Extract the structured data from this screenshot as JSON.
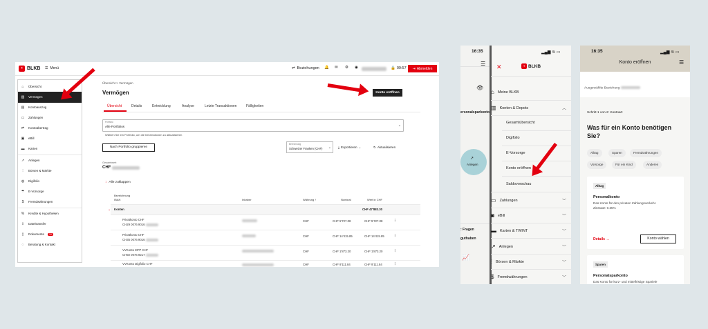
{
  "desktop": {
    "brand": "BLKB",
    "menu": "Menü",
    "top": {
      "relations": "Beziehungen",
      "time": "09:57",
      "logout": "Abmelden"
    },
    "sidebar": [
      "Übersicht",
      "Vermögen",
      "Kontoauszug",
      "Zahlungen",
      "Kontoübertrag",
      "eBill",
      "Karten",
      "Anlegen",
      "Börsen & Märkte",
      "Digifolio",
      "E-Vorsorge",
      "Fremdwährungen",
      "Kredite & Hypotheken",
      "Dateitransfer",
      "Dokumente",
      "Beratung & Kontakt"
    ],
    "doc_badge": "10",
    "breadcrumb": "Übersicht > Vermögen",
    "title": "Vermögen",
    "open_account": "Konto eröffnen",
    "tabs": [
      "Übersicht",
      "Details",
      "Entwicklung",
      "Analyse",
      "Letzte Transaktionen",
      "Fälligkeiten"
    ],
    "portfolio_label": "Portfolio",
    "portfolio_value": "Alle Portfolios",
    "portfolio_hint": "Wählen Sie ein Portfolio, um die Informationen zu aktualisieren",
    "group_button": "Nach Portfolio gruppieren",
    "currency_label": "Berechnung",
    "currency_value": "Schweizer Franken (CHF)",
    "export": "Exportieren",
    "refresh": "Aktualisieren",
    "total_label": "Gesamtwert",
    "total_prefix": "CHF",
    "collapse": "Alle zuklappen",
    "cols": {
      "name": "Bezeichnung",
      "iban": "IBAN",
      "holder": "Inhaber",
      "currency": "Währung",
      "nominal": "Nominal",
      "value": "Wert in CHF"
    },
    "group": {
      "name": "Konten",
      "value": "CHF 47'883.30"
    },
    "rows": [
      {
        "name": "Privatkonto CHF",
        "iban": "CH29 0076 9016",
        "cur": "CHF",
        "nominal": "CHF 5'727.08",
        "value": "CHF 5'727.08"
      },
      {
        "name": "Privatkonto CHF",
        "iban": "CH35 0076 9016",
        "cur": "CHF",
        "nominal": "CHF 14'415.85",
        "value": "CHF 14'415.85"
      },
      {
        "name": "VVKonto MFP CHF",
        "iban": "CH92 0076 9217",
        "cur": "CHF",
        "nominal": "CHF 1'873.20",
        "value": "CHF 1'873.20"
      },
      {
        "name": "VVKonto Digifolio CHF",
        "iban": "",
        "cur": "CHF",
        "nominal": "CHF 9'111.84",
        "value": "CHF 9'111.84"
      }
    ]
  },
  "phone1": {
    "time": "16:35",
    "brand": "BLKB",
    "behind": {
      "section": "ersonalsparkonto",
      "anlegen": "Anlegen",
      "frage": ": Fragen",
      "guthaben": "guthaben"
    },
    "menu": [
      {
        "label": "Meine BLKB",
        "icon": "house-icon"
      },
      {
        "label": "Konten & Depots",
        "icon": "bank-icon"
      },
      {
        "label": "Zahlungen",
        "icon": "payment-icon"
      },
      {
        "label": "eBill",
        "icon": "ebill-icon"
      },
      {
        "label": "Karten & TWINT",
        "icon": "card-icon"
      },
      {
        "label": "Anlegen",
        "icon": "chart-icon"
      },
      {
        "label": "Börsen & Märkte",
        "icon": "market-icon"
      },
      {
        "label": "Fremdwährungen",
        "icon": "dollar-icon"
      }
    ],
    "submenu": [
      "Gesamtübersicht",
      "Digifolio",
      "E-Vorsorge",
      "Konto eröffnen",
      "Saldovorschau"
    ]
  },
  "phone2": {
    "time": "16:35",
    "title": "Konto eröffnen",
    "relation_label": "Ausgewählte Beziehung",
    "step": "Schritt 1 von 2: Kontoart",
    "question": "Was für ein Konto benötigen Sie?",
    "chips": [
      "Alltag",
      "Sparen",
      "Fremdwährungen",
      "Vorsorge",
      "Für ein Kind",
      "Anderes"
    ],
    "card1": {
      "tag": "Alltag",
      "title": "Personalkonto",
      "desc": "Das Konto für den privaten Zahlungsverkehr.",
      "rate": "Zinssatz: 0.35%",
      "details": "Details →",
      "button": "Konto wählen"
    },
    "card2": {
      "tag": "Sparen",
      "title": "Personalsparkonto",
      "desc": "Das Konto für kurz- und mittelfristige Spariele"
    }
  },
  "colors": {
    "brand_red": "#e3000f",
    "dark": "#222222",
    "accent_teal": "#a9d2d8",
    "header_beige": "#d8d3c7"
  }
}
